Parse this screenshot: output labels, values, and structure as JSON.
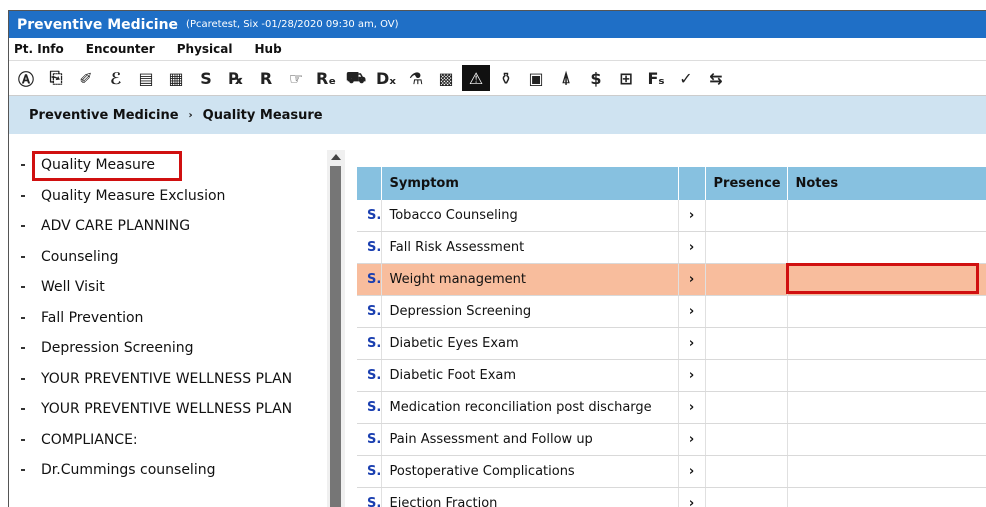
{
  "window": {
    "title": "Preventive Medicine",
    "subtitle": "(Pcaretest, Six -01/28/2020 09:30 am, OV)"
  },
  "menu": [
    "Pt. Info",
    "Encounter",
    "Physical",
    "Hub"
  ],
  "toolbar": [
    {
      "glyph": "Ⓐ",
      "name": "a-icon"
    },
    {
      "glyph": "⎘",
      "name": "copy-icon"
    },
    {
      "glyph": "✐",
      "name": "pill-icon"
    },
    {
      "glyph": "ℰ",
      "name": "script-e-icon"
    },
    {
      "glyph": "▤",
      "name": "note-icon"
    },
    {
      "glyph": "▦",
      "name": "image-icon"
    },
    {
      "glyph": "S",
      "name": "s-icon"
    },
    {
      "glyph": "℞",
      "name": "rx-bracket-icon"
    },
    {
      "glyph": "R",
      "name": "r-icon"
    },
    {
      "glyph": "☞",
      "name": "hand-icon"
    },
    {
      "glyph": "Rₑ",
      "name": "re-icon"
    },
    {
      "glyph": "⛟",
      "name": "cup-icon"
    },
    {
      "glyph": "Dₓ",
      "name": "dx-icon"
    },
    {
      "glyph": "⚗",
      "name": "rx-bottle-icon"
    },
    {
      "glyph": "▩",
      "name": "grid-icon"
    },
    {
      "glyph": "⚠",
      "name": "alert-file-icon",
      "active": true
    },
    {
      "glyph": "⚱",
      "name": "lab-tubes-icon"
    },
    {
      "glyph": "▣",
      "name": "calculator-icon"
    },
    {
      "glyph": "⍋",
      "name": "person-icon"
    },
    {
      "glyph": "$",
      "name": "billing-icon"
    },
    {
      "glyph": "⊞",
      "name": "document-icon"
    },
    {
      "glyph": "Fₛ",
      "name": "fs-icon"
    },
    {
      "glyph": "✓",
      "name": "checkmark-icon"
    },
    {
      "glyph": "⇆",
      "name": "transfer-icon"
    }
  ],
  "breadcrumb": {
    "root": "Preventive Medicine",
    "separator": "›",
    "current": "Quality Measure"
  },
  "sidebar": {
    "items": [
      {
        "label": "Quality Measure",
        "selected": true
      },
      {
        "label": "Quality Measure Exclusion"
      },
      {
        "label": "ADV CARE PLANNING"
      },
      {
        "label": "Counseling"
      },
      {
        "label": "Well Visit"
      },
      {
        "label": "Fall Prevention"
      },
      {
        "label": "Depression Screening"
      },
      {
        "label": "YOUR PREVENTIVE WELLNESS PLAN"
      },
      {
        "label": "YOUR PREVENTIVE WELLNESS PLAN"
      },
      {
        "label": "COMPLIANCE:"
      },
      {
        "label": "Dr.Cummings counseling"
      }
    ]
  },
  "grid": {
    "columns": {
      "symptom": "Symptom",
      "presence": "Presence",
      "notes": "Notes"
    },
    "s_marker": "S.",
    "chevron": "›",
    "rows": [
      {
        "symptom": "Tobacco Counseling",
        "presence": "",
        "notes": ""
      },
      {
        "symptom": "Fall Risk Assessment",
        "presence": "",
        "notes": ""
      },
      {
        "symptom": "Weight management",
        "presence": "",
        "notes": "",
        "selected": true
      },
      {
        "symptom": "Depression Screening",
        "presence": "",
        "notes": ""
      },
      {
        "symptom": "Diabetic Eyes Exam",
        "presence": "",
        "notes": ""
      },
      {
        "symptom": "Diabetic Foot Exam",
        "presence": "",
        "notes": ""
      },
      {
        "symptom": "Medication reconciliation post discharge",
        "presence": "",
        "notes": ""
      },
      {
        "symptom": "Pain Assessment and Follow up",
        "presence": "",
        "notes": ""
      },
      {
        "symptom": "Postoperative Complications",
        "presence": "",
        "notes": ""
      },
      {
        "symptom": "Ejection Fraction",
        "presence": "",
        "notes": ""
      }
    ]
  },
  "colors": {
    "titlebar": "#1f6fc6",
    "breadcrumb": "#cfe3f1",
    "header": "#87c1e0",
    "selected_row": "#f8bd9d",
    "highlight": "#d01010",
    "s_marker": "#1a3fb0"
  }
}
